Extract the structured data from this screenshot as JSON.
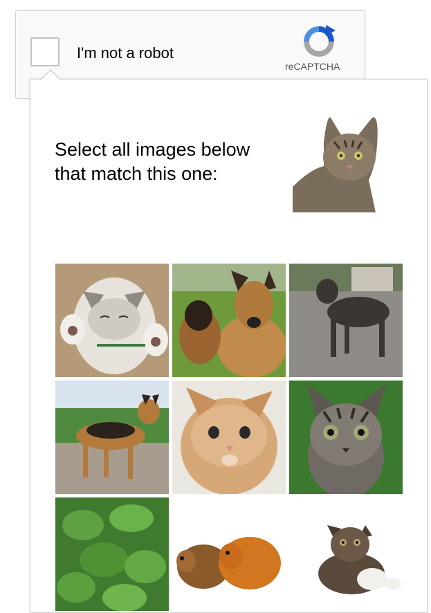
{
  "widget": {
    "checkbox_label": "I'm not a robot",
    "logo_text": "reCAPTCHA"
  },
  "challenge": {
    "instruction_line1": "Select all images below",
    "instruction_line2": "that match this one:",
    "reference_image": "tabby-cat-photo",
    "grid_images": [
      "kitten-paws-up-photo",
      "german-shepherd-with-puppy-photo",
      "black-dog-photo",
      "german-shepherd-standing-photo",
      "ginger-kitten-photo",
      "tabby-kitten-photo",
      "green-plant-leaves-photo",
      "guinea-pigs-photo",
      "calico-kitten-photo"
    ]
  }
}
